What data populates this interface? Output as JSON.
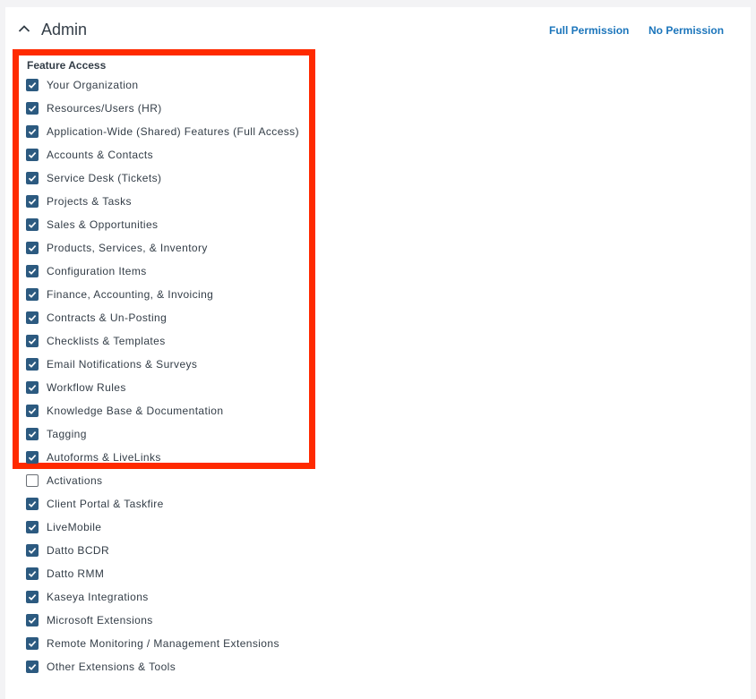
{
  "section": {
    "title": "Admin",
    "full_permission_label": "Full Permission",
    "no_permission_label": "No Permission"
  },
  "feature_access": {
    "label": "Feature Access",
    "items": [
      {
        "label": "Your Organization",
        "checked": true
      },
      {
        "label": "Resources/Users (HR)",
        "checked": true
      },
      {
        "label": "Application-Wide (Shared) Features (Full Access)",
        "checked": true
      },
      {
        "label": "Accounts & Contacts",
        "checked": true
      },
      {
        "label": "Service Desk (Tickets)",
        "checked": true
      },
      {
        "label": "Projects & Tasks",
        "checked": true
      },
      {
        "label": "Sales & Opportunities",
        "checked": true
      },
      {
        "label": "Products, Services, & Inventory",
        "checked": true
      },
      {
        "label": "Configuration Items",
        "checked": true
      },
      {
        "label": "Finance, Accounting, & Invoicing",
        "checked": true
      },
      {
        "label": "Contracts & Un-Posting",
        "checked": true
      },
      {
        "label": "Checklists & Templates",
        "checked": true
      },
      {
        "label": "Email Notifications & Surveys",
        "checked": true
      },
      {
        "label": "Workflow Rules",
        "checked": true
      },
      {
        "label": "Knowledge Base & Documentation",
        "checked": true
      },
      {
        "label": "Tagging",
        "checked": true
      },
      {
        "label": "Autoforms & LiveLinks",
        "checked": true
      },
      {
        "label": "Activations",
        "checked": false
      },
      {
        "label": "Client Portal & Taskfire",
        "checked": true
      },
      {
        "label": "LiveMobile",
        "checked": true
      },
      {
        "label": "Datto BCDR",
        "checked": true
      },
      {
        "label": "Datto RMM",
        "checked": true
      },
      {
        "label": "Kaseya Integrations",
        "checked": true
      },
      {
        "label": "Microsoft Extensions",
        "checked": true
      },
      {
        "label": "Remote Monitoring / Management Extensions",
        "checked": true
      },
      {
        "label": "Other Extensions & Tools",
        "checked": true
      }
    ]
  },
  "icons": {
    "collapse": "chevron-up-icon",
    "checked": "check-icon"
  },
  "colors": {
    "link": "#1b75bb",
    "checkbox_checked": "#2c5a80",
    "highlight": "#ff2a00",
    "text": "#333d47"
  }
}
